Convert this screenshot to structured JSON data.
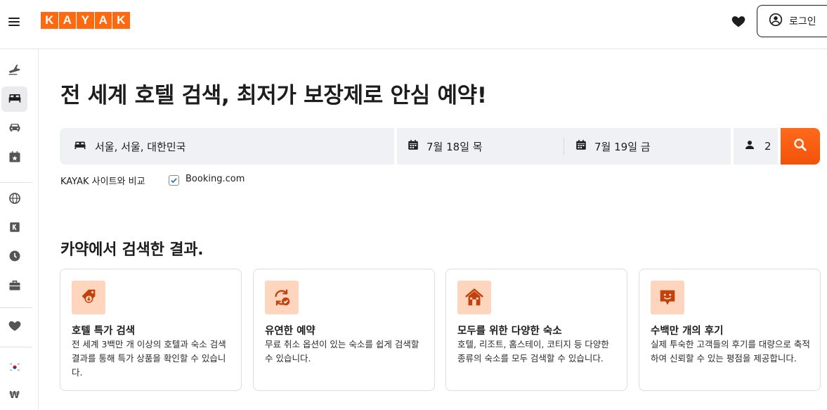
{
  "brand": {
    "letters": [
      "K",
      "A",
      "Y",
      "A",
      "K"
    ],
    "color": "#ff690f"
  },
  "header": {
    "login_label": "로그인",
    "icons": [
      "menu-icon",
      "heart-icon",
      "user-circle-icon"
    ]
  },
  "sidebar": {
    "items": [
      {
        "name": "flights",
        "icon": "plane-icon",
        "active": false
      },
      {
        "name": "stays",
        "icon": "bed-icon",
        "active": true
      },
      {
        "name": "cars",
        "icon": "car-icon",
        "active": false
      },
      {
        "name": "packages",
        "icon": "calendar-star-icon",
        "active": false
      },
      {
        "name": "explore",
        "icon": "globe-icon",
        "active": false
      },
      {
        "name": "kayak",
        "icon": "k-logo-icon",
        "active": false
      },
      {
        "name": "trips",
        "icon": "clock-icon",
        "active": false
      },
      {
        "name": "business",
        "icon": "briefcase-icon",
        "active": false
      },
      {
        "name": "saved",
        "icon": "heart-icon",
        "active": false
      },
      {
        "name": "language",
        "icon": "korea-flag-icon",
        "active": false
      }
    ],
    "currency": "₩"
  },
  "hero": {
    "title": "전 세계 호텔 검색, 최저가 보장제로 안심 예약!"
  },
  "search": {
    "destination": "서울, 서울, 대한민국",
    "checkin": "7월 18일 목",
    "checkout": "7월 19일 금",
    "guests": "2",
    "accent": "#ff5a0f"
  },
  "compare": {
    "label": "KAYAK 사이트와 비교",
    "option_label": "Booking.com",
    "option_checked": true
  },
  "features": {
    "title": "카약에서 검색한 결과.",
    "cards": [
      {
        "icon": "price-tag-icon",
        "title": "호텔 특가 검색",
        "desc": "전 세계 3백만 개 이상의 호텔과 숙소 검색 결과를 통해 특가 상품을 확인할 수 있습니다."
      },
      {
        "icon": "refresh-check-icon",
        "title": "유연한 예약",
        "desc": "무료 취소 옵션이 있는 숙소를 쉽게 검색할 수 있습니다."
      },
      {
        "icon": "house-icon",
        "title": "모두를 위한 다양한 숙소",
        "desc": "호텔, 리조트, 홈스테이, 코티지 등 다양한 종류의 숙소를 모두 검색할 수 있습니다."
      },
      {
        "icon": "review-chat-icon",
        "title": "수백만 개의 후기",
        "desc": "실제 투숙한 고객들의 후기를 대량으로 축적하여 신뢰할 수 있는 평점을 제공합니다."
      }
    ]
  }
}
